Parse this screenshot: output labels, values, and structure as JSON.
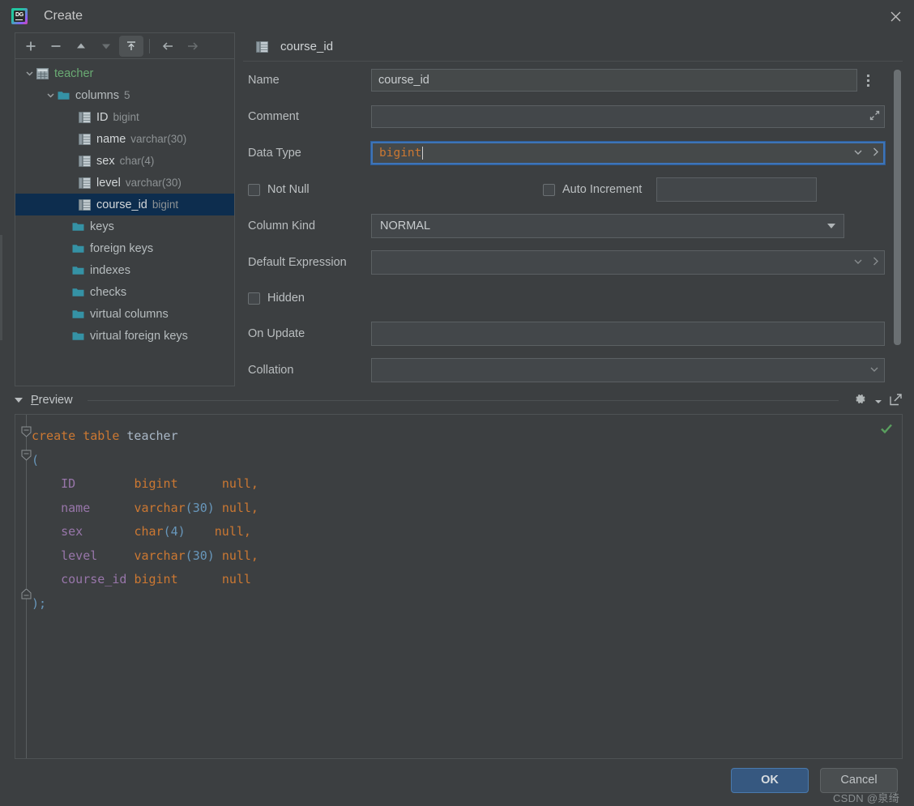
{
  "window": {
    "title": "Create",
    "app_icon": "datagrip-icon",
    "close_icon": "close-icon"
  },
  "tree_toolbar": {
    "buttons": [
      {
        "name": "add-button",
        "icon": "plus-icon",
        "state": "enabled"
      },
      {
        "name": "remove-button",
        "icon": "minus-icon",
        "state": "enabled"
      },
      {
        "name": "move-up-button",
        "icon": "arrow-up-icon",
        "state": "enabled"
      },
      {
        "name": "move-down-button",
        "icon": "arrow-down-icon",
        "state": "disabled"
      },
      {
        "name": "apply-button",
        "icon": "submit-icon",
        "state": "active"
      },
      {
        "name": "navigate-back-button",
        "icon": "arrow-left-icon",
        "state": "enabled"
      },
      {
        "name": "navigate-forward-button",
        "icon": "arrow-right-icon",
        "state": "disabled"
      }
    ]
  },
  "tree": {
    "root": {
      "label": "teacher",
      "icon": "table-icon",
      "expanded": true
    },
    "columns_group": {
      "label": "columns",
      "count": "5",
      "icon": "folder-icon",
      "expanded": true
    },
    "columns": [
      {
        "name": "ID",
        "type": "bigint",
        "icon": "column-icon",
        "selected": false
      },
      {
        "name": "name",
        "type": "varchar(30)",
        "icon": "column-icon",
        "selected": false
      },
      {
        "name": "sex",
        "type": "char(4)",
        "icon": "column-icon",
        "selected": false
      },
      {
        "name": "level",
        "type": "varchar(30)",
        "icon": "column-icon",
        "selected": false
      },
      {
        "name": "course_id",
        "type": "bigint",
        "icon": "column-icon",
        "selected": true
      }
    ],
    "groups": [
      {
        "label": "keys",
        "icon": "folder-icon"
      },
      {
        "label": "foreign keys",
        "icon": "folder-icon"
      },
      {
        "label": "indexes",
        "icon": "folder-icon"
      },
      {
        "label": "checks",
        "icon": "folder-icon"
      },
      {
        "label": "virtual columns",
        "icon": "folder-icon"
      },
      {
        "label": "virtual foreign keys",
        "icon": "folder-icon"
      }
    ]
  },
  "form": {
    "header": {
      "title": "course_id",
      "icon": "column-icon"
    },
    "name": {
      "label": "Name",
      "value": "course_id",
      "menu_icon": "more-options-icon"
    },
    "comment": {
      "label": "Comment",
      "value": "",
      "expand_icon": "expand-icon"
    },
    "data_type": {
      "label": "Data Type",
      "value": "bigint",
      "focused": true,
      "dropdown_icon": "chevron-down-icon",
      "browse_icon": "chevron-right-icon"
    },
    "not_null": {
      "label": "Not Null",
      "checked": false
    },
    "auto_increment": {
      "label": "Auto Increment",
      "checked": false,
      "value": ""
    },
    "column_kind": {
      "label": "Column Kind",
      "value": "NORMAL",
      "dropdown_icon": "triangle-down-icon"
    },
    "default_expression": {
      "label": "Default Expression",
      "value": "",
      "dropdown_icon": "chevron-down-icon",
      "browse_icon": "chevron-right-icon"
    },
    "hidden": {
      "label": "Hidden",
      "checked": false
    },
    "on_update": {
      "label": "On Update",
      "value": ""
    },
    "collation": {
      "label": "Collation",
      "value": "",
      "dropdown_icon": "chevron-down-icon"
    }
  },
  "preview": {
    "title": "Preview",
    "title_mnemonic": "P",
    "title_rest": "review",
    "expanded": true,
    "settings_icon": "gear-icon",
    "open_external_icon": "open-external-icon",
    "status_icon": "checkmark-ok-icon",
    "sql": {
      "line1_keyword": "create table",
      "line1_table": "teacher",
      "open_paren": "(",
      "close_paren": ");",
      "columns": [
        {
          "name": "ID",
          "type": "bigint",
          "type_len": "",
          "null": "null,"
        },
        {
          "name": "name",
          "type": "varchar",
          "type_len": "30",
          "null": "null,"
        },
        {
          "name": "sex",
          "type": "char",
          "type_len": "4",
          "null": "null,"
        },
        {
          "name": "level",
          "type": "varchar",
          "type_len": "30",
          "null": "null,"
        },
        {
          "name": "course_id",
          "type": "bigint",
          "type_len": "",
          "null": "null"
        }
      ]
    }
  },
  "footer": {
    "ok_label": "OK",
    "cancel_label": "Cancel",
    "watermark": "CSDN @泉绮"
  },
  "colors": {
    "background": "#3c3f41",
    "selection": "#0d2d4e",
    "accent_blue": "#365880",
    "focus_border": "#3d74b8",
    "keyword_orange": "#cc7832",
    "identifier_purple": "#9876aa",
    "number_blue": "#6897bb",
    "table_green": "#6aab73",
    "folder_teal": "#3592a5",
    "ok_green": "#599e5e"
  }
}
